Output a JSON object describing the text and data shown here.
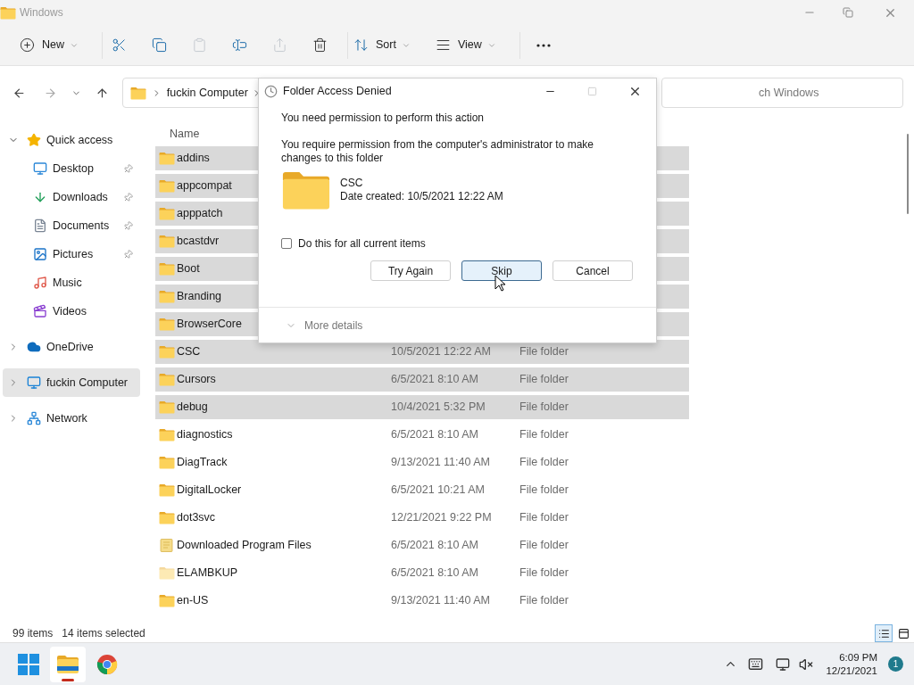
{
  "window": {
    "title": "Windows"
  },
  "toolbar": [
    {
      "kind": "new",
      "label": "New",
      "disabled": false
    },
    {
      "kind": "cut",
      "disabled": false
    },
    {
      "kind": "copy",
      "disabled": false
    },
    {
      "kind": "paste",
      "disabled": true
    },
    {
      "kind": "rename",
      "disabled": false
    },
    {
      "kind": "share",
      "disabled": true
    },
    {
      "kind": "delete",
      "disabled": false
    },
    {
      "kind": "sort",
      "label": "Sort",
      "disabled": false
    },
    {
      "kind": "view",
      "label": "View",
      "disabled": false
    },
    {
      "kind": "more",
      "disabled": false
    }
  ],
  "nav": {
    "back": {
      "disabled": false
    },
    "forward": {
      "disabled": true
    }
  },
  "address": {
    "crumbs": [
      "fuckin Computer"
    ]
  },
  "search": {
    "placeholder": "ch Windows"
  },
  "sidebar": {
    "items": [
      {
        "kind": "star",
        "label": "Quick access",
        "expanded": true,
        "selected": false,
        "children": [
          {
            "kind": "desktop",
            "label": "Desktop",
            "pinned": true,
            "selected": false
          },
          {
            "kind": "downloads",
            "label": "Downloads",
            "pinned": true,
            "selected": false
          },
          {
            "kind": "documents",
            "label": "Documents",
            "pinned": true,
            "selected": false
          },
          {
            "kind": "pictures",
            "label": "Pictures",
            "pinned": true,
            "selected": false
          },
          {
            "kind": "music",
            "label": "Music",
            "pinned": false,
            "selected": false
          },
          {
            "kind": "videos",
            "label": "Videos",
            "pinned": false,
            "selected": false
          }
        ]
      },
      {
        "kind": "cloud",
        "label": "OneDrive",
        "expanded": false,
        "selected": false
      },
      {
        "kind": "computer",
        "label": "fuckin Computer",
        "expanded": false,
        "selected": true
      },
      {
        "kind": "network",
        "label": "Network",
        "expanded": false,
        "selected": false
      }
    ]
  },
  "file_list": {
    "columns": [
      "Name"
    ],
    "rows": [
      {
        "kind": "folder",
        "name": "addins",
        "selected": true
      },
      {
        "kind": "folder",
        "name": "appcompat",
        "selected": true
      },
      {
        "kind": "folder",
        "name": "apppatch",
        "selected": true
      },
      {
        "kind": "folder",
        "name": "bcastdvr",
        "selected": true
      },
      {
        "kind": "folder",
        "name": "Boot",
        "selected": true
      },
      {
        "kind": "folder",
        "name": "Branding",
        "selected": true
      },
      {
        "kind": "folder",
        "name": "BrowserCore",
        "selected": true
      },
      {
        "kind": "folder",
        "name": "CSC",
        "date": "10/5/2021 12:22 AM",
        "type": "File folder",
        "selected": true
      },
      {
        "kind": "folder",
        "name": "Cursors",
        "date": "6/5/2021 8:10 AM",
        "type": "File folder",
        "selected": true
      },
      {
        "kind": "folder",
        "name": "debug",
        "date": "10/4/2021 5:32 PM",
        "type": "File folder",
        "selected": true
      },
      {
        "kind": "folder",
        "name": "diagnostics",
        "date": "6/5/2021 8:10 AM",
        "type": "File folder",
        "selected": false
      },
      {
        "kind": "folder",
        "name": "DiagTrack",
        "date": "9/13/2021 11:40 AM",
        "type": "File folder",
        "selected": false
      },
      {
        "kind": "folder",
        "name": "DigitalLocker",
        "date": "6/5/2021 10:21 AM",
        "type": "File folder",
        "selected": false
      },
      {
        "kind": "folder",
        "name": "dot3svc",
        "date": "12/21/2021 9:22 PM",
        "type": "File folder",
        "selected": false
      },
      {
        "kind": "special",
        "name": "Downloaded Program Files",
        "date": "6/5/2021 8:10 AM",
        "type": "File folder",
        "selected": false
      },
      {
        "kind": "hidden",
        "name": "ELAMBKUP",
        "date": "6/5/2021 8:10 AM",
        "type": "File folder",
        "selected": false
      },
      {
        "kind": "folder",
        "name": "en-US",
        "date": "9/13/2021 11:40 AM",
        "type": "File folder",
        "selected": false
      }
    ]
  },
  "status_bar": {
    "count": "99 items",
    "selection": "14 items selected",
    "views": [
      {
        "kind": "details",
        "selected": true
      },
      {
        "kind": "tiles",
        "selected": false
      }
    ]
  },
  "dialog": {
    "title": "Folder Access Denied",
    "heading": "You need permission to perform this action",
    "message": "You require permission from the computer's administrator to make changes to this folder",
    "item_name": "CSC",
    "item_detail": "Date created: 10/5/2021 12:22 AM",
    "checkbox": {
      "label": "Do this for all current items",
      "checked": false
    },
    "buttons": [
      {
        "label": "Try Again",
        "default": false
      },
      {
        "label": "Skip",
        "default": true
      },
      {
        "label": "Cancel",
        "default": false
      }
    ],
    "details": {
      "label": "More details",
      "expanded": false
    }
  },
  "taskbar": {
    "apps": [
      {
        "kind": "start",
        "active": false
      },
      {
        "kind": "explorer",
        "active": true
      },
      {
        "kind": "browser",
        "active": false
      }
    ],
    "time": "6:09 PM",
    "date": "12/21/2021",
    "notifications": "1"
  }
}
